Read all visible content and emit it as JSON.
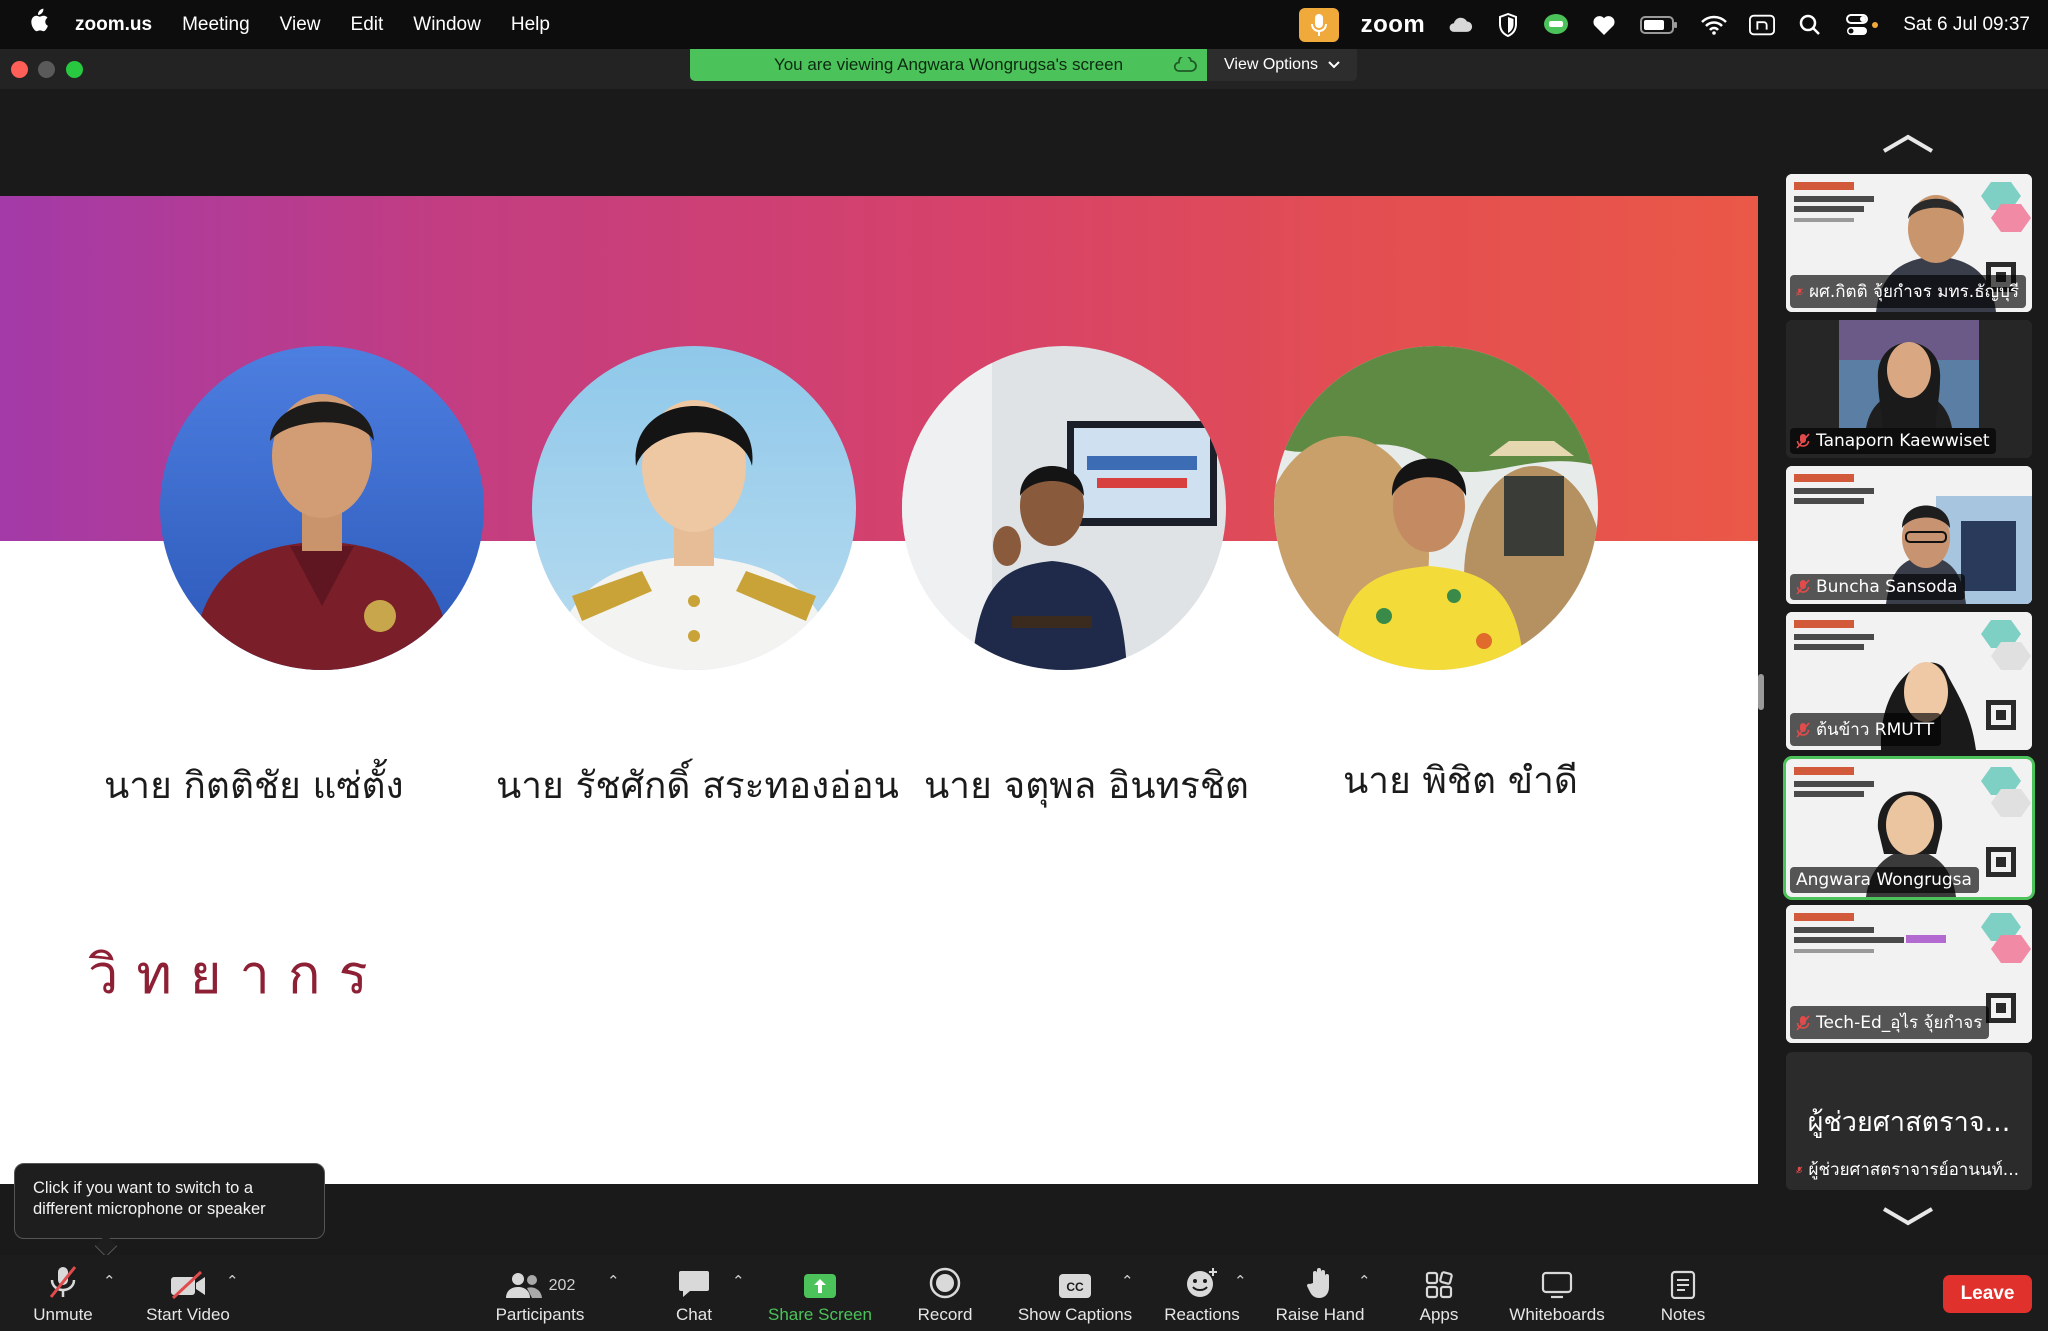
{
  "menubar": {
    "app_name": "zoom.us",
    "menus": [
      "Meeting",
      "View",
      "Edit",
      "Window",
      "Help"
    ],
    "zoom_tray": "zoom",
    "clock": "Sat 6 Jul  09:37"
  },
  "banner": {
    "viewing_text": "You are viewing Angwara Wongrugsa's screen",
    "view_options": "View Options"
  },
  "slide": {
    "speakers": [
      "นาย กิตติชัย แซ่ตั้ง",
      "นาย รัชศักดิ์ สระทองอ่อน",
      "นาย จตุพล อินทรชิต",
      "นาย พิชิต ขำดี"
    ],
    "heading": "วิทยากร"
  },
  "gallery": {
    "tiles": [
      {
        "name": "ผศ.กิตติ จุ้ยกำจร มทร.ธัญบุรี",
        "muted": true
      },
      {
        "name": "Tanaporn Kaewwiset",
        "muted": true
      },
      {
        "name": "Buncha Sansoda",
        "muted": true
      },
      {
        "name": "ต้นข้าว RMUTT",
        "muted": true
      },
      {
        "name": "Angwara Wongrugsa",
        "muted": false,
        "active": true
      },
      {
        "name": "Tech-Ed_อุไร จุ้ยกำจร",
        "muted": true
      },
      {
        "name": "ผู้ช่วยศาสตราจารย์อานนท์...",
        "display": "ผู้ช่วยศาสตราจ...",
        "muted": true
      }
    ]
  },
  "tooltip": {
    "text": "Click if you want to switch to a different microphone or speaker"
  },
  "toolbar": {
    "unmute": "Unmute",
    "start_video": "Start Video",
    "participants": "Participants",
    "participant_count": "202",
    "chat": "Chat",
    "share_screen": "Share Screen",
    "record": "Record",
    "show_captions": "Show Captions",
    "reactions": "Reactions",
    "raise_hand": "Raise Hand",
    "apps": "Apps",
    "whiteboards": "Whiteboards",
    "notes": "Notes",
    "leave": "Leave"
  },
  "colors": {
    "accent_green": "#4cc35a",
    "leave_red": "#e0312d",
    "slide_heading": "#8e2036"
  }
}
